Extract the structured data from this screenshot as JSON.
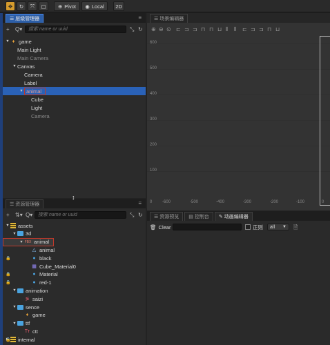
{
  "toolbar": {
    "pivot_label": "Pivot",
    "local_label": "Local",
    "mode_2d_label": "2D"
  },
  "hierarchy": {
    "tab_title": "层级管理器",
    "search_placeholder": "搜索 name or uuid",
    "nodes": [
      {
        "label": "game",
        "depth": 0,
        "arrow": "▼",
        "icon": "fire-icon",
        "dim": false
      },
      {
        "label": "Main Light",
        "depth": 1,
        "arrow": "",
        "icon": "",
        "dim": false
      },
      {
        "label": "Main Camera",
        "depth": 1,
        "arrow": "",
        "icon": "",
        "dim": true
      },
      {
        "label": "Canvas",
        "depth": 1,
        "arrow": "▼",
        "icon": "",
        "dim": false
      },
      {
        "label": "Camera",
        "depth": 2,
        "arrow": "",
        "icon": "",
        "dim": false
      },
      {
        "label": "Label",
        "depth": 2,
        "arrow": "",
        "icon": "",
        "dim": false
      },
      {
        "label": "animal",
        "depth": 2,
        "arrow": "▼",
        "icon": "",
        "dim": false,
        "selected": true
      },
      {
        "label": "Cube",
        "depth": 3,
        "arrow": "",
        "icon": "",
        "dim": false
      },
      {
        "label": "Light",
        "depth": 3,
        "arrow": "",
        "icon": "",
        "dim": false
      },
      {
        "label": "Camera",
        "depth": 3,
        "arrow": "",
        "icon": "",
        "dim": true
      }
    ]
  },
  "assets": {
    "tab_title": "资源管理器",
    "search_placeholder": "搜索 name or uuid",
    "nodes": [
      {
        "label": "assets",
        "depth": 0,
        "arrow": "▼",
        "icon": "database-icon"
      },
      {
        "label": "3d",
        "depth": 1,
        "arrow": "▼",
        "icon": "folder-icon"
      },
      {
        "label": "animal",
        "depth": 2,
        "arrow": "▼",
        "icon": "fbx-icon",
        "highlight": true,
        "prefix": "FBX"
      },
      {
        "label": "animal",
        "depth": 3,
        "arrow": "",
        "icon": "mesh-icon"
      },
      {
        "label": "black",
        "depth": 3,
        "arrow": "",
        "icon": "material-icon",
        "lock": true
      },
      {
        "label": "Cube_Material0",
        "depth": 3,
        "arrow": "",
        "icon": "material-grid-icon"
      },
      {
        "label": "Material",
        "depth": 3,
        "arrow": "",
        "icon": "material-icon",
        "lock": true
      },
      {
        "label": "red-1",
        "depth": 3,
        "arrow": "",
        "icon": "material-icon",
        "lock": true
      },
      {
        "label": "animation",
        "depth": 1,
        "arrow": "▼",
        "icon": "folder-icon"
      },
      {
        "label": "saizi",
        "depth": 2,
        "arrow": "",
        "icon": "animation-clip-icon"
      },
      {
        "label": "sence",
        "depth": 1,
        "arrow": "▼",
        "icon": "folder-icon"
      },
      {
        "label": "game",
        "depth": 2,
        "arrow": "",
        "icon": "fire-icon"
      },
      {
        "label": "ttf",
        "depth": 1,
        "arrow": "▼",
        "icon": "folder-icon"
      },
      {
        "label": "ctt",
        "depth": 2,
        "arrow": "",
        "icon": "font-icon",
        "prefix": "Tт"
      },
      {
        "label": "internal",
        "depth": 0,
        "arrow": "▶",
        "icon": "database-icon",
        "lock": true
      }
    ]
  },
  "scene": {
    "tab_title": "场景编辑器",
    "y_labels": [
      "600",
      "500",
      "400",
      "300",
      "200",
      "100"
    ],
    "x_labels": [
      "0",
      "-600",
      "-500",
      "-400",
      "-300",
      "-200",
      "-100",
      "0"
    ]
  },
  "console": {
    "tabs": [
      "资源预览",
      "控制台",
      "动画编辑器"
    ],
    "clear_label": "Clear",
    "regex_label": "正则",
    "level_value": "all"
  }
}
